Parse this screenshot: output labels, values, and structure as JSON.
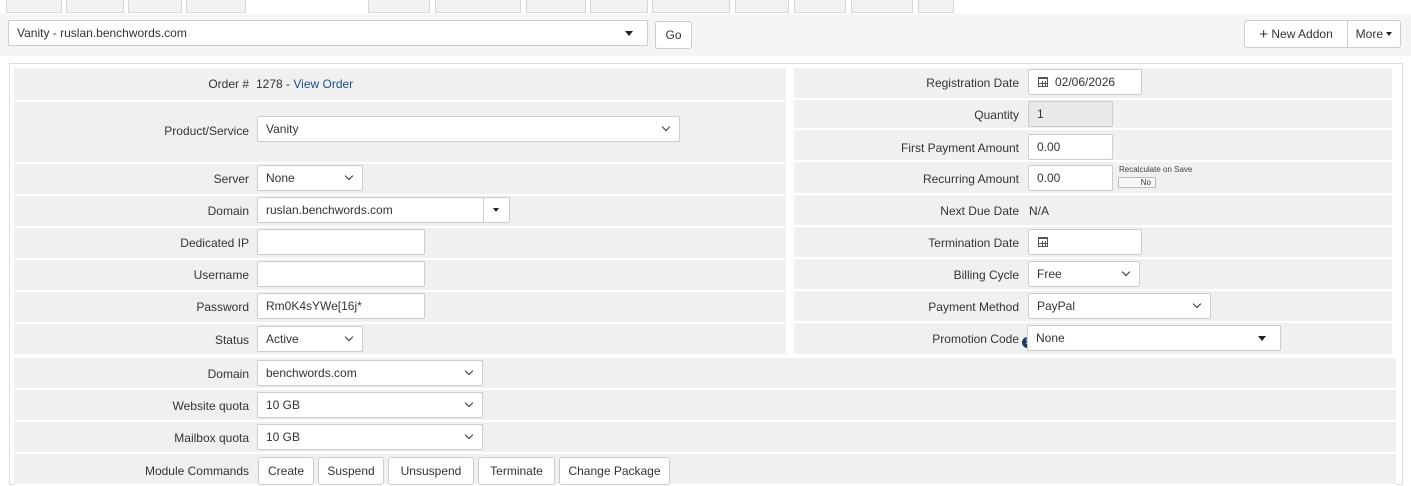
{
  "top": {
    "addon_select_value": "Vanity - ruslan.benchwords.com",
    "go_label": "Go",
    "new_addon_label": "New Addon",
    "more_label": "More"
  },
  "left": {
    "order": {
      "label": "Order #",
      "number": "1278",
      "separator": " - ",
      "link": "View Order"
    },
    "product": {
      "label": "Product/Service",
      "value": "Vanity"
    },
    "server": {
      "label": "Server",
      "value": "None"
    },
    "domain": {
      "label": "Domain",
      "value": "ruslan.benchwords.com"
    },
    "dedicated_ip": {
      "label": "Dedicated IP",
      "value": ""
    },
    "username": {
      "label": "Username",
      "value": ""
    },
    "password": {
      "label": "Password",
      "value": "Rm0K4sYWe[16j*"
    },
    "status": {
      "label": "Status",
      "value": "Active"
    }
  },
  "right": {
    "registration_date": {
      "label": "Registration Date",
      "value": "02/06/2026"
    },
    "quantity": {
      "label": "Quantity",
      "value": "1"
    },
    "first_payment": {
      "label": "First Payment Amount",
      "value": "0.00"
    },
    "recurring": {
      "label": "Recurring Amount",
      "value": "0.00",
      "recalc_label": "Recalculate on Save",
      "recalc_toggle": "No"
    },
    "next_due": {
      "label": "Next Due Date",
      "value": "N/A"
    },
    "termination": {
      "label": "Termination Date",
      "value": ""
    },
    "billing_cycle": {
      "label": "Billing Cycle",
      "value": "Free"
    },
    "payment_method": {
      "label": "Payment Method",
      "value": "PayPal"
    },
    "promotion": {
      "label": "Promotion Code",
      "value": "None"
    }
  },
  "bottom": {
    "domain2": {
      "label": "Domain",
      "value": "benchwords.com"
    },
    "website_quota": {
      "label": "Website quota",
      "value": "10 GB"
    },
    "mailbox_quota": {
      "label": "Mailbox quota",
      "value": "10 GB"
    },
    "module_commands": {
      "label": "Module Commands",
      "buttons": [
        "Create",
        "Suspend",
        "Unsuspend",
        "Terminate",
        "Change Package"
      ]
    }
  },
  "icons": {
    "plus": "plus-icon",
    "calendar": "calendar-icon",
    "info": "info-icon",
    "caret": "caret-down-icon"
  }
}
